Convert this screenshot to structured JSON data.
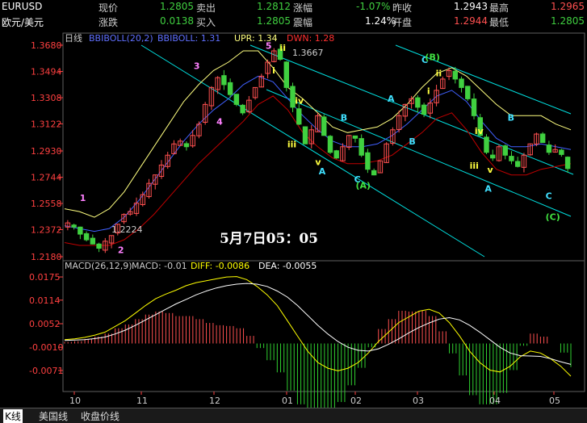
{
  "header": {
    "row1": {
      "symbol": "EURUSD",
      "price_label": "现价",
      "price": "1.2805",
      "sell_label": "卖出",
      "sell": "1.2812",
      "pct_label": "涨幅",
      "pct": "-1.07%",
      "prevclose_label": "昨收",
      "prevclose": "1.2943",
      "high_label": "最高",
      "high": "1.2965"
    },
    "row2": {
      "name": "欧元/美元",
      "change_label": "涨跌",
      "change": "0.0138",
      "buy_label": "买入",
      "buy": "1.2805",
      "amp_label": "震幅",
      "amp": "1.24%",
      "open_label": "开盘",
      "open": "1.2944",
      "low_label": "最低",
      "low": "1.2805"
    }
  },
  "colors": {
    "up": "#ff5050",
    "down": "#40d040",
    "boll_upper": "#ffff80",
    "boll_mid": "#4060ff",
    "boll_lower": "#c00000",
    "channel": "#00e0e0",
    "macd_dif": "#ffff00",
    "macd_dea": "#ffffff"
  },
  "chart_data": [
    {
      "type": "candlestick",
      "title": "日线",
      "indicator_label": "BBIBOLL(20,2) BBIBOLL: 1.31 UPR: 1.34 DWN: 1.28",
      "indicator_parts": {
        "name": "BBIBOLL(20,2)",
        "mid": "BBIBOLL: 1.31",
        "upr": "UPR: 1.34",
        "dwn": "DWN: 1.28"
      },
      "ylim": [
        1.218,
        1.368
      ],
      "y_ticks": [
        "1.3680",
        "1.3494",
        "1.3308",
        "1.3122",
        "1.2930",
        "1.2744",
        "1.2558",
        "1.2372",
        "1.2180"
      ],
      "x_ticks": [
        "10",
        "11",
        "12",
        "01",
        "02",
        "03",
        "04",
        "05"
      ],
      "high_marker": "1.3667",
      "low_marker": "1.2224",
      "annotation_date": "5月7日05：05",
      "wave_labels": [
        {
          "text": "1",
          "x": 0.03,
          "y": 1.2575
        },
        {
          "text": "2",
          "x": 0.105,
          "y": 1.2205
        },
        {
          "text": "3",
          "x": 0.255,
          "y": 1.351
        },
        {
          "text": "4",
          "x": 0.3,
          "y": 1.3115
        },
        {
          "text": "5",
          "x": 0.397,
          "y": 1.3655
        },
        {
          "text": "i",
          "x": 0.41,
          "y": 1.348
        },
        {
          "text": "ii",
          "x": 0.425,
          "y": 1.364
        },
        {
          "text": "iii",
          "x": 0.44,
          "y": 1.2955
        },
        {
          "text": "iv",
          "x": 0.455,
          "y": 1.3265
        },
        {
          "text": "v",
          "x": 0.495,
          "y": 1.283
        },
        {
          "text": "A",
          "x": 0.502,
          "y": 1.2765
        },
        {
          "text": "B",
          "x": 0.545,
          "y": 1.3145
        },
        {
          "text": "C",
          "x": 0.572,
          "y": 1.2708
        },
        {
          "text": "(A)",
          "x": 0.575,
          "y": 1.2665
        },
        {
          "text": "A",
          "x": 0.638,
          "y": 1.328
        },
        {
          "text": "B",
          "x": 0.68,
          "y": 1.2975
        },
        {
          "text": "C",
          "x": 0.705,
          "y": 1.3555
        },
        {
          "text": "(B)",
          "x": 0.712,
          "y": 1.3575
        },
        {
          "text": "ii",
          "x": 0.733,
          "y": 1.346
        },
        {
          "text": "i",
          "x": 0.716,
          "y": 1.3335
        },
        {
          "text": "iii",
          "x": 0.8,
          "y": 1.2805
        },
        {
          "text": "iv",
          "x": 0.81,
          "y": 1.305
        },
        {
          "text": "v",
          "x": 0.835,
          "y": 1.2775
        },
        {
          "text": "A",
          "x": 0.83,
          "y": 1.264
        },
        {
          "text": "B",
          "x": 0.875,
          "y": 1.3145
        },
        {
          "text": "C",
          "x": 0.95,
          "y": 1.259
        },
        {
          "text": "(C)",
          "x": 0.95,
          "y": 1.244
        }
      ],
      "close_path": [
        1.242,
        1.239,
        1.234,
        1.23,
        1.227,
        1.224,
        1.229,
        1.233,
        1.241,
        1.248,
        1.25,
        1.256,
        1.262,
        1.27,
        1.276,
        1.283,
        1.29,
        1.298,
        1.3,
        1.296,
        1.304,
        1.312,
        1.326,
        1.338,
        1.345,
        1.34,
        1.333,
        1.326,
        1.32,
        1.329,
        1.338,
        1.346,
        1.356,
        1.364,
        1.358,
        1.338,
        1.324,
        1.312,
        1.298,
        1.308,
        1.318,
        1.304,
        1.292,
        1.288,
        1.296,
        1.304,
        1.302,
        1.29,
        1.28,
        1.276,
        1.286,
        1.298,
        1.308,
        1.318,
        1.326,
        1.33,
        1.324,
        1.319,
        1.327,
        1.336,
        1.344,
        1.35,
        1.344,
        1.338,
        1.33,
        1.318,
        1.304,
        1.292,
        1.288,
        1.296,
        1.29,
        1.286,
        1.282,
        1.29,
        1.298,
        1.305,
        1.299,
        1.292,
        1.294,
        1.2905,
        1.2805
      ],
      "boll_upper_path": [
        1.252,
        1.25,
        1.246,
        1.252,
        1.264,
        1.28,
        1.296,
        1.312,
        1.328,
        1.34,
        1.35,
        1.356,
        1.364,
        1.364,
        1.352,
        1.338,
        1.33,
        1.32,
        1.31,
        1.306,
        1.308,
        1.31,
        1.316,
        1.326,
        1.338,
        1.348,
        1.352,
        1.346,
        1.336,
        1.326,
        1.318,
        1.318,
        1.318,
        1.312,
        1.308
      ],
      "boll_mid_path": [
        1.24,
        1.238,
        1.236,
        1.238,
        1.246,
        1.258,
        1.272,
        1.286,
        1.3,
        1.312,
        1.322,
        1.33,
        1.34,
        1.346,
        1.342,
        1.33,
        1.318,
        1.308,
        1.3,
        1.296,
        1.296,
        1.298,
        1.304,
        1.312,
        1.322,
        1.332,
        1.336,
        1.328,
        1.314,
        1.302,
        1.296,
        1.296,
        1.298,
        1.296,
        1.294
      ],
      "boll_lower_path": [
        1.228,
        1.226,
        1.226,
        1.226,
        1.23,
        1.238,
        1.248,
        1.26,
        1.272,
        1.284,
        1.294,
        1.304,
        1.314,
        1.326,
        1.332,
        1.322,
        1.306,
        1.296,
        1.288,
        1.284,
        1.284,
        1.286,
        1.29,
        1.298,
        1.306,
        1.316,
        1.32,
        1.308,
        1.292,
        1.28,
        1.276,
        1.276,
        1.28,
        1.282,
        1.284
      ]
    },
    {
      "type": "macd",
      "indicator_label": "MACD(26,12,9) MACD: -0.01 DIFF: -0.0086 DEA: -0.0055",
      "indicator_parts": {
        "name": "MACD(26,12,9)",
        "macd": "MACD: -0.01",
        "diff": "DIFF: -0.0086",
        "dea": "DEA: -0.0055"
      },
      "ylim": [
        -0.012,
        0.019
      ],
      "y_ticks": [
        "0.0175",
        "0.0114",
        "0.0052",
        "-0.0010",
        "-0.0071"
      ],
      "dif_path": [
        0.001,
        0.0012,
        0.0016,
        0.0022,
        0.003,
        0.0045,
        0.006,
        0.008,
        0.01,
        0.0118,
        0.013,
        0.014,
        0.0152,
        0.016,
        0.0165,
        0.017,
        0.0175,
        0.0176,
        0.0168,
        0.015,
        0.0128,
        0.01,
        0.006,
        0.002,
        -0.002,
        -0.005,
        -0.0065,
        -0.0072,
        -0.0065,
        -0.005,
        -0.0025,
        0.0005,
        0.003,
        0.0055,
        0.007,
        0.0085,
        0.009,
        0.008,
        0.0055,
        0.002,
        -0.002,
        -0.005,
        -0.007,
        -0.0075,
        -0.006,
        -0.0035,
        -0.002,
        -0.0025,
        -0.004,
        -0.006,
        -0.0086
      ],
      "dea_path": [
        0.0008,
        0.0009,
        0.001,
        0.0013,
        0.0017,
        0.0025,
        0.0035,
        0.0048,
        0.0062,
        0.0076,
        0.009,
        0.0104,
        0.0116,
        0.0128,
        0.0138,
        0.0146,
        0.0152,
        0.0156,
        0.0158,
        0.0156,
        0.015,
        0.0138,
        0.0122,
        0.01,
        0.0074,
        0.0048,
        0.0025,
        0.0005,
        -0.001,
        -0.0018,
        -0.002,
        -0.0014,
        -0.0002,
        0.0012,
        0.0028,
        0.0042,
        0.0054,
        0.0064,
        0.0068,
        0.0062,
        0.0048,
        0.003,
        0.001,
        -0.001,
        -0.0025,
        -0.0032,
        -0.0033,
        -0.0034,
        -0.004,
        -0.0048,
        -0.0055
      ]
    }
  ],
  "bottom_tabs": [
    "K线",
    "美国线",
    "收盘价线"
  ]
}
